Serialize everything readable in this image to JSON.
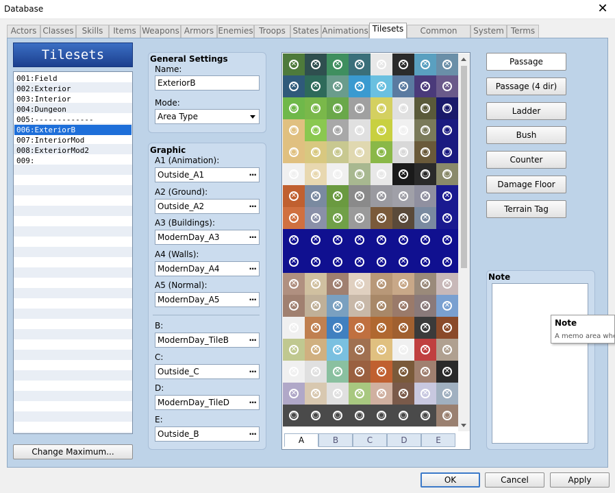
{
  "window": {
    "title": "Database",
    "close_glyph": "✕"
  },
  "tabs": [
    {
      "label": "Actors"
    },
    {
      "label": "Classes"
    },
    {
      "label": "Skills"
    },
    {
      "label": "Items"
    },
    {
      "label": "Weapons"
    },
    {
      "label": "Armors"
    },
    {
      "label": "Enemies"
    },
    {
      "label": "Troops"
    },
    {
      "label": "States"
    },
    {
      "label": "Animations"
    },
    {
      "label": "Tilesets",
      "active": true
    },
    {
      "label": "Common Events"
    },
    {
      "label": "System"
    },
    {
      "label": "Terms"
    }
  ],
  "tilesets": {
    "header": "Tilesets",
    "items": [
      "001:Field",
      "002:Exterior",
      "003:Interior",
      "004:Dungeon",
      "005:-------------",
      "006:ExteriorB",
      "007:InteriorMod",
      "008:ExteriorMod2",
      "009:"
    ],
    "selected_index": 5,
    "change_max_label": "Change Maximum..."
  },
  "general": {
    "title": "General Settings",
    "name_label": "Name:",
    "name_value": "ExteriorB",
    "mode_label": "Mode:",
    "mode_value": "Area Type"
  },
  "graphic": {
    "title": "Graphic",
    "fields": [
      {
        "label": "A1 (Animation):",
        "value": "Outside_A1"
      },
      {
        "label": "A2 (Ground):",
        "value": "Outside_A2"
      },
      {
        "label": "A3 (Buildings):",
        "value": "ModernDay_A3"
      },
      {
        "label": "A4 (Walls):",
        "value": "ModernDay_A4"
      },
      {
        "label": "A5 (Normal):",
        "value": "ModernDay_A5"
      },
      {
        "label": "B:",
        "value": "ModernDay_TileB"
      },
      {
        "label": "C:",
        "value": "Outside_C"
      },
      {
        "label": "D:",
        "value": "ModernDay_TileD"
      },
      {
        "label": "E:",
        "value": "Outside_B"
      }
    ],
    "browse_glyph": "···"
  },
  "tile_tabs": [
    {
      "label": "A",
      "active": true
    },
    {
      "label": "B"
    },
    {
      "label": "C"
    },
    {
      "label": "D"
    },
    {
      "label": "E"
    }
  ],
  "tile_marks": {
    "circle": "○",
    "cross": "✕"
  },
  "flags": {
    "buttons": [
      "Passage",
      "Passage (4 dir)",
      "Ladder",
      "Bush",
      "Counter",
      "Damage Floor",
      "Terrain Tag"
    ],
    "selected_index": 0
  },
  "note": {
    "title": "Note",
    "value": ""
  },
  "tooltip": {
    "title": "Note",
    "text": "A memo area whe"
  },
  "footer": {
    "ok": "OK",
    "cancel": "Cancel",
    "apply": "Apply"
  }
}
